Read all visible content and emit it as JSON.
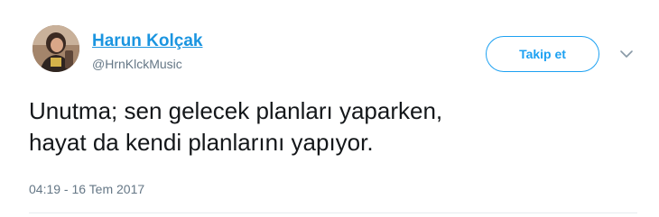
{
  "author": {
    "name": "Harun Kolçak",
    "handle": "@HrnKlckMusic",
    "avatar_icon": "user-avatar-photo"
  },
  "actions": {
    "follow_label": "Takip et",
    "more_icon": "chevron-down-icon"
  },
  "tweet": {
    "text_lines": [
      "Unutma; sen gelecek planları yaparken,",
      "hayat da kendi planlarını yapıyor."
    ],
    "timestamp": "04:19 - 16 Tem 2017"
  },
  "colors": {
    "link_blue": "#1b95e0",
    "accent_blue": "#1da1f2",
    "secondary_text": "#657786",
    "primary_text": "#14171a",
    "divider": "#e6ecf0"
  }
}
